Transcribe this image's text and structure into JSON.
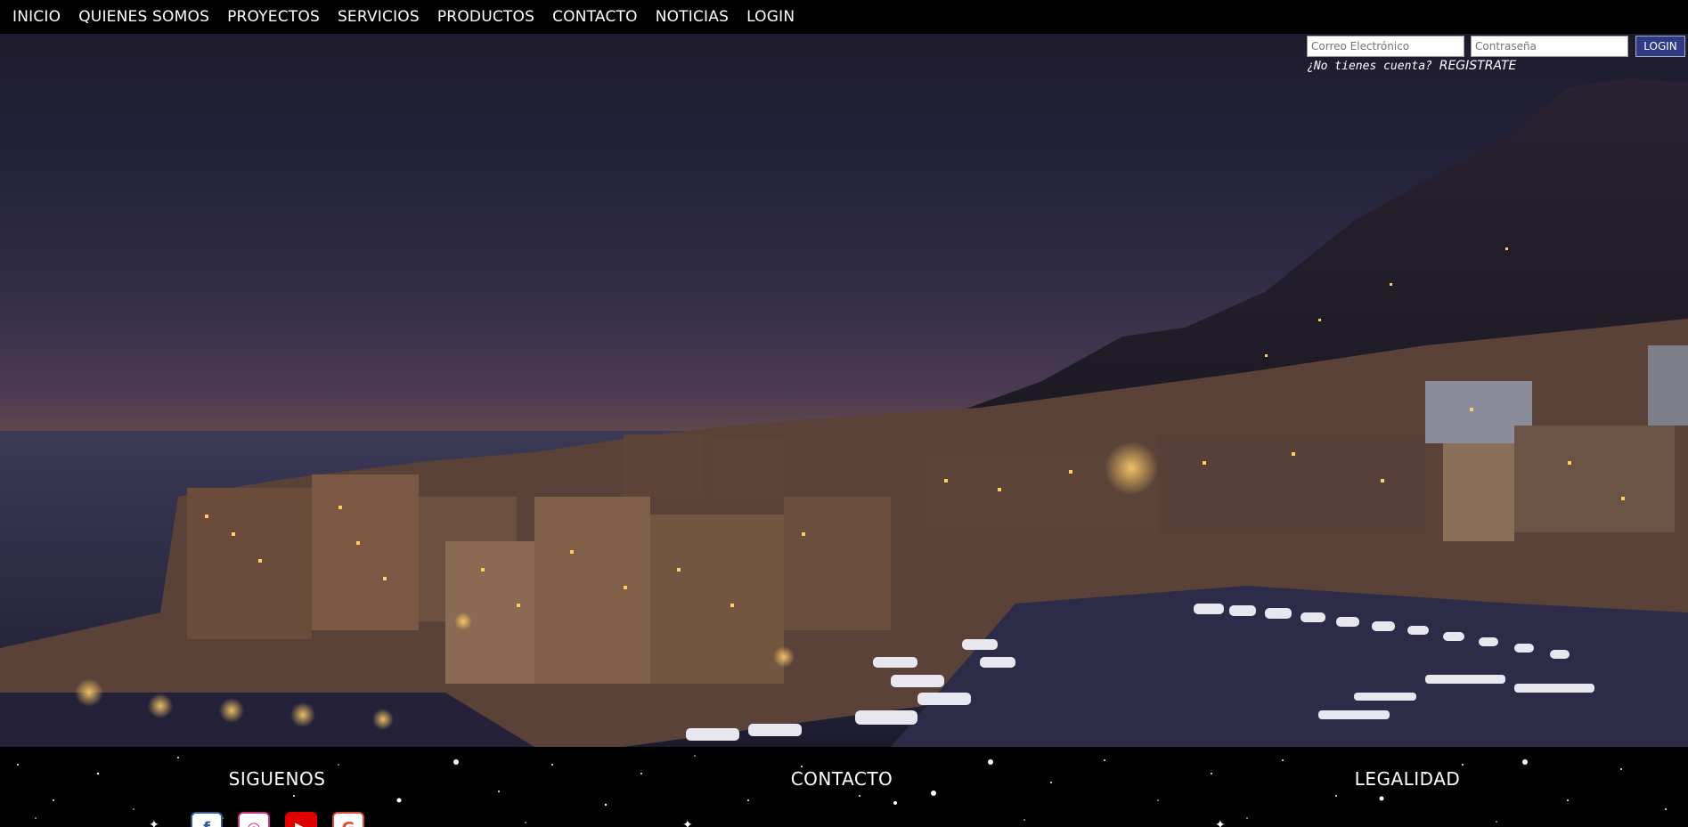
{
  "nav": {
    "items": [
      "INICIO",
      "QUIENES SOMOS",
      "PROYECTOS",
      "SERVICIOS",
      "PRODUCTOS",
      "CONTACTO",
      "NOTICIAS",
      "LOGIN"
    ]
  },
  "login": {
    "email_placeholder": "Correo Electrónico",
    "password_placeholder": "Contraseña",
    "button_label": "LOGIN",
    "no_account_text": "¿No tienes cuenta?",
    "register_link": "REGISTRATE"
  },
  "footer": {
    "follow_title": "SIGUENOS",
    "contact_title": "CONTACTO",
    "legal_title": "LEGALIDAD",
    "social_icons": [
      "facebook-icon",
      "instagram-icon",
      "youtube-icon",
      "google-plus-icon"
    ],
    "colors": {
      "facebook": "#3b5998",
      "instagram": "#c13584",
      "youtube": "#e00000",
      "googleplus": "#dd4b39",
      "login_button": "#2f3b86"
    }
  }
}
